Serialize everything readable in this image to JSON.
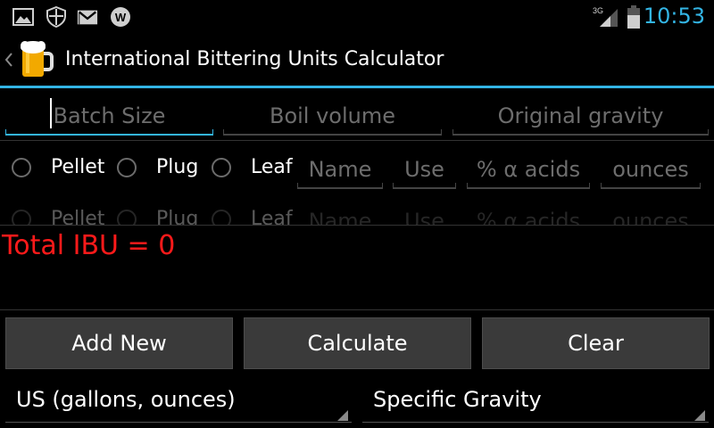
{
  "status_bar": {
    "network": "3G",
    "time": "10:53",
    "icons": [
      "image-icon",
      "shield-icon",
      "gmail-icon",
      "whatsapp-icon",
      "signal-icon",
      "battery-icon"
    ]
  },
  "action_bar": {
    "title": "International Bittering Units Calculator"
  },
  "inputs": {
    "batch_size": {
      "placeholder": "Batch Size"
    },
    "boil_volume": {
      "placeholder": "Boil volume"
    },
    "original_gravity": {
      "placeholder": "Original gravity"
    }
  },
  "hops": [
    {
      "types": [
        "Pellet",
        "Plug",
        "Leaf"
      ],
      "name_placeholder": "Name",
      "use_placeholder": "Use",
      "acids_placeholder": "% α acids",
      "ounces_placeholder": "ounces"
    },
    {
      "types": [
        "Pellet",
        "Plug",
        "Leaf"
      ],
      "name_placeholder": "Name",
      "use_placeholder": "Use",
      "acids_placeholder": "% α acids",
      "ounces_placeholder": "ounces"
    }
  ],
  "total": {
    "text": "Total IBU = 0"
  },
  "buttons": {
    "add_new": "Add New",
    "calculate": "Calculate",
    "clear": "Clear"
  },
  "spinners": {
    "units": "US (gallons, ounces)",
    "gravity": "Specific Gravity"
  },
  "colors": {
    "accent": "#33b5e5",
    "total": "#ff1a1a"
  }
}
